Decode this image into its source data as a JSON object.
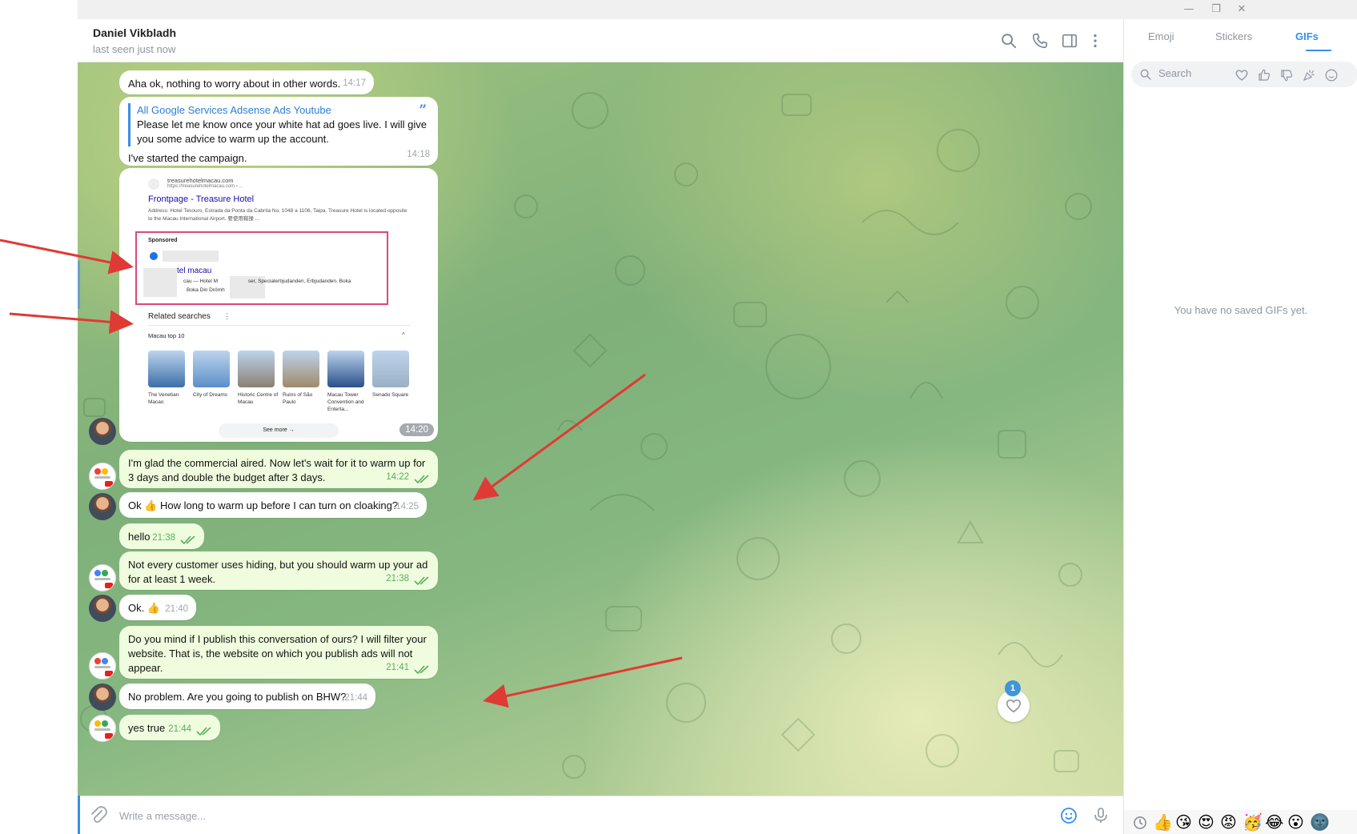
{
  "window": {
    "minimize_glyph": "—",
    "restore_glyph": "❐",
    "close_glyph": "✕"
  },
  "header": {
    "contact_name": "Daniel Vikbladh",
    "status": "last seen just now",
    "icons": [
      "search-icon",
      "phone-icon",
      "sidebar-toggle-icon",
      "more-icon"
    ]
  },
  "messages": [
    {
      "text": "Aha ok, nothing to worry about in other words.",
      "time": "14:17",
      "direction": "in"
    },
    {
      "reply_title": "All Google Services Adsense Ads Youtube",
      "reply_text": "Please let me know once your white hat ad goes live. I will give you some advice to warm up the account.",
      "text": "I've started the campaign.",
      "time": "14:18",
      "direction": "in"
    },
    {
      "type": "screenshot",
      "time": "14:20",
      "direction": "in"
    },
    {
      "text": "I'm glad the commercial aired. Now let's wait for it to warm up for 3 days and double the budget after 3 days.",
      "time": "14:22",
      "direction": "out"
    },
    {
      "text": "Ok 👍 How long to warm up before I can turn on cloaking?",
      "time": "14:25",
      "direction": "in"
    },
    {
      "text": "hello",
      "time": "21:38",
      "direction": "out"
    },
    {
      "text": "Not every customer uses hiding, but you should warm up your ad for at least 1 week.",
      "time": "21:38",
      "direction": "out"
    },
    {
      "text": "Ok. 👍",
      "time": "21:40",
      "direction": "in"
    },
    {
      "text": "Do you mind if I publish this conversation of ours? I will filter your website. That is, the website on which you publish ads will not appear.",
      "time": "21:41",
      "direction": "out"
    },
    {
      "text": "No problem. Are you going to publish on BHW?",
      "time": "21:44",
      "direction": "in"
    },
    {
      "text": "yes true",
      "time": "21:44",
      "direction": "out"
    }
  ],
  "screenshot": {
    "site_name": "treasurehotelmacau.com",
    "site_url": "https://treasurehotelmacau.com › ...",
    "result_title": "Frontpage - Treasure Hotel",
    "result_desc": "Address: Hotel Tesouro, Estrada da Ponta da Cabrita No. 1048 a 1106, Taipa. Treasure Hotel is located opposite to the Macau International Airport. 要使用鞍操 ...",
    "sponsored_label": "Sponsored",
    "sponsored_link": "tel macau",
    "sponsored_desc1": "cau — Hotel M",
    "sponsored_desc1b": "ser, Specialerbjudanden, Erbjudanden. Boka",
    "sponsored_desc2": "Boka Din Drömh",
    "related_title": "Related searches",
    "related_menu": "⋮",
    "top10_label": "Macau top 10",
    "caret": "^",
    "places": [
      {
        "name": "The Venetian Macao",
        "color": "#3d6ea8"
      },
      {
        "name": "City of Dreams",
        "color": "#5b8fc8"
      },
      {
        "name": "Historic Centre of Macau",
        "color": "#8a8074"
      },
      {
        "name": "Ruins of São Paulo",
        "color": "#a08a6a"
      },
      {
        "name": "Macau Tower Convention and Enterta...",
        "color": "#2a4f8a"
      },
      {
        "name": "Senado Square",
        "color": "#9bb0c4"
      }
    ],
    "see_more": "See more →"
  },
  "reaction": {
    "badge_count": "1",
    "icon": "heart-icon"
  },
  "composer": {
    "placeholder": "Write a message...",
    "icons": [
      "attach-icon",
      "emoji-icon",
      "mic-icon"
    ]
  },
  "panel": {
    "tabs": [
      "Emoji",
      "Stickers",
      "GIFs"
    ],
    "active_tab": "GIFs",
    "search_placeholder": "Search",
    "empty_text": "You have no saved GIFs yet.",
    "category_icons": [
      "heart-icon",
      "thumbs-up-icon",
      "thumbs-down-icon",
      "party-icon",
      "smile-icon"
    ],
    "emojis": [
      "👍",
      "😘",
      "😍",
      "😡",
      "🥳",
      "😂",
      "😮",
      "🌚"
    ]
  },
  "colors": {
    "accent": "#3390ec",
    "outgoing_bubble": "#effdde",
    "arrow": "#e03a34",
    "sponsored_border": "#e0467b"
  }
}
